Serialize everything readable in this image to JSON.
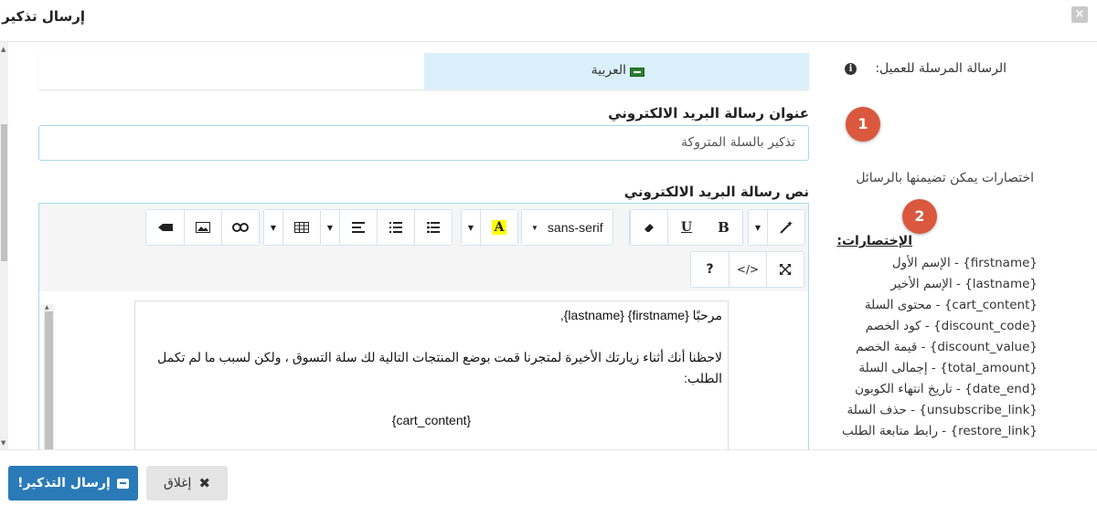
{
  "modal": {
    "title": "إرسال تذكير",
    "close_icon": "×"
  },
  "right_panel": {
    "message_label": "الرسالة المرسلة للعميل:",
    "info_icon": "i",
    "badge1": "1",
    "badge2": "2",
    "description": "اختصارات يمكن تضيمنها بالرسائل",
    "shortcuts_title": "الإختصارات:",
    "shortcuts": [
      "{firstname} - الإسم الأول",
      "{lastname} - الإسم الأخير",
      "{cart_content} - محتوى السلة",
      "{discount_code} - كود الخصم",
      "{discount_value} - قيمة الخصم",
      "{total_amount} - إجمالى السلة",
      "{date_end} - تاريخ انتهاء الكوبون",
      "{unsubscribe_link} - حذف السلة",
      "{restore_link} - رابط متابعة الطلب"
    ]
  },
  "tabs": {
    "active_label": "العربية"
  },
  "subject": {
    "label": "عنوان رسالة البريد الالكتروني",
    "value": "تذكير بالسلة المتروكة"
  },
  "body": {
    "label": "نص رسالة البريد الالكتروني",
    "toolbar": {
      "font_name": "sans-serif",
      "bold": "B",
      "underline": "U",
      "font_color": "A",
      "help": "?",
      "code_view": "</>"
    },
    "content": {
      "line1": "مرحبًا {firstname} {lastname},",
      "line2": "لاحظنا أنك أثناء زيارتك الأخيرة لمتجرنا قمت بوضع المنتجات التالية لك سلة التسوق ، ولكن لسبب ما لم تكمل الطلب:",
      "line3": "{cart_content}"
    }
  },
  "footer": {
    "send_label": "إرسال التذكير!",
    "close_label": "إغلاق"
  },
  "colors": {
    "primary": "#2a7ab8",
    "badge": "#d9583e",
    "tab_active": "#d9f0fb"
  }
}
